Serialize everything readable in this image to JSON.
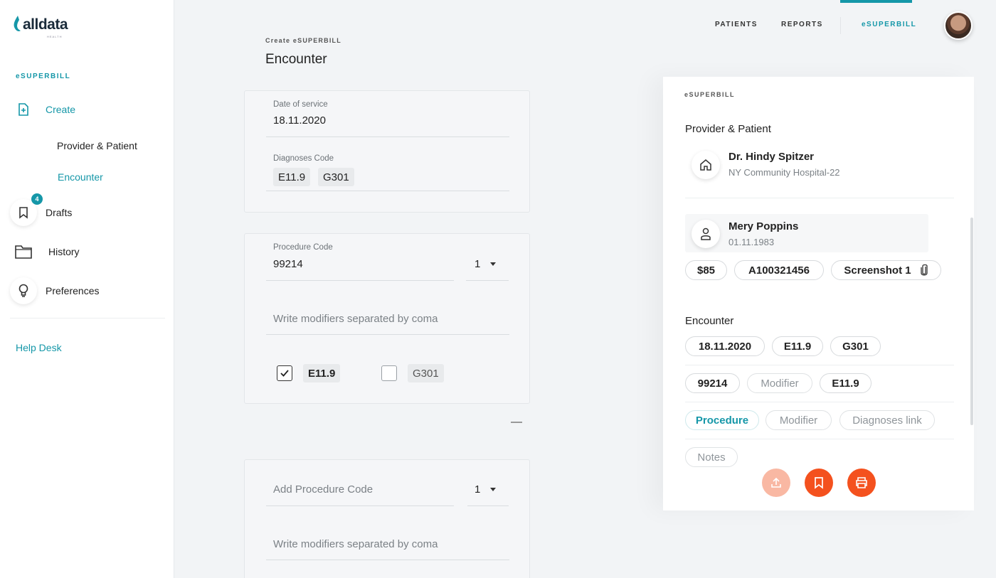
{
  "brand": {
    "logo_text": "alldata",
    "logo_sub": "HEALTH"
  },
  "sidebar": {
    "section_label": "eSUPERBILL",
    "create_label": "Create",
    "sub_items": [
      "Provider & Patient",
      "Encounter"
    ],
    "drafts_label": "Drafts",
    "drafts_count": "4",
    "history_label": "History",
    "preferences_label": "Preferences",
    "help_label": "Help Desk"
  },
  "topnav": {
    "patients": "PATIENTS",
    "reports": "REPORTS",
    "esuperbill": "eSUPERBILL"
  },
  "form": {
    "crumb": "Create eSUPERBILL",
    "title": "Encounter",
    "date_label": "Date of service",
    "date_value": "18.11.2020",
    "diagnoses_label": "Diagnoses Code",
    "diagnoses": [
      "E11.9",
      "G301"
    ],
    "procedure_label": "Procedure Code",
    "procedure_value": "99214",
    "procedure_qty": "1",
    "modifier_placeholder": "Write modifiers separated by coma",
    "links": [
      {
        "code": "E11.9",
        "checked": true
      },
      {
        "code": "G301",
        "checked": false
      }
    ],
    "add_procedure_placeholder": "Add Procedure Code",
    "add_qty": "1",
    "modifier_placeholder_2": "Write modifiers separated by coma"
  },
  "panel": {
    "eyebrow": "eSUPERBILL",
    "provider_heading": "Provider & Patient",
    "provider_name": "Dr. Hindy Spitzer",
    "provider_sub": "NY Community Hospital-22",
    "patient_name": "Mery Poppins",
    "patient_dob": "01.11.1983",
    "tags": {
      "amount": "$85",
      "id": "A100321456",
      "attachment": "Screenshot 1"
    },
    "encounter_heading": "Encounter",
    "row1": [
      "18.11.2020",
      "E11.9",
      "G301"
    ],
    "row2": [
      "99214",
      "Modifier",
      "E11.9"
    ],
    "row3": [
      "Procedure",
      "Modifier",
      "Diagnoses link"
    ],
    "notes": "Notes"
  },
  "colors": {
    "accent": "#1597a8",
    "action": "#f4511e"
  }
}
